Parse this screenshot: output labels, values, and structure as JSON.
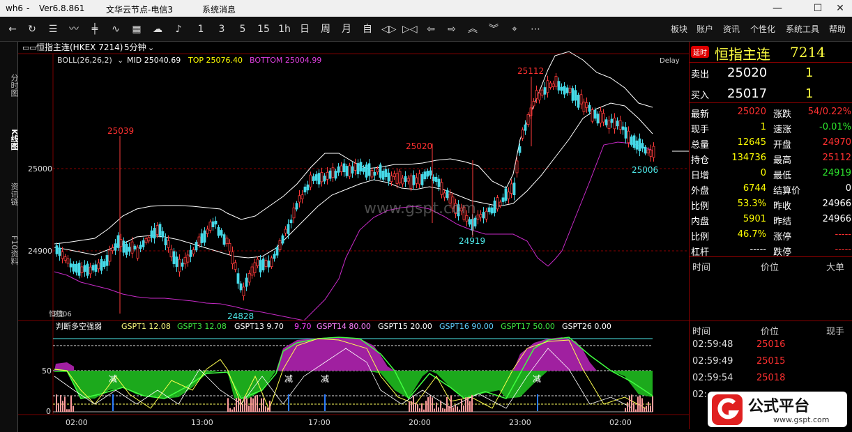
{
  "titlebar": {
    "app": "wh6",
    "sep": "-",
    "version": "Ver6.8.861",
    "server": "文华云节点-电信3",
    "sysmsg": "系统消息"
  },
  "toolbar": {
    "periods": [
      "1",
      "3",
      "5",
      "15",
      "1h",
      "日",
      "周",
      "月",
      "自"
    ],
    "menus": [
      "板块",
      "账户",
      "资讯",
      "个性化",
      "系统工具",
      "帮助"
    ]
  },
  "sidetabs": [
    "分时图",
    "K线图",
    "资讯链",
    "F10资料"
  ],
  "chart": {
    "header_left": "恒指主连(HKEX 7214)",
    "period": "5分钟",
    "boll_label": "BOLL(26,26,2)",
    "mid": "MID 25040.69",
    "top": "TOP 25076.40",
    "bottom": "BOTTOM 25004.99",
    "delay": "Delay",
    "price_labels": [
      "25000",
      "24900"
    ],
    "annotations": [
      "25112",
      "25039",
      "25020",
      "24919",
      "24828",
      "25006"
    ],
    "lower_label": "判断多空强弱",
    "gspt": [
      "GSPT1 12.08",
      "GSPT3 12.08",
      "GSPT13 9.70",
      "9.70",
      "GSPT14 80.00",
      "GSPT15 20.00",
      "GSPT16 90.00",
      "GSPT17 50.00",
      "GSPT26 0.00"
    ],
    "lower_axis": [
      "50",
      "0"
    ],
    "reduce_marks": [
      "减",
      "减",
      "减",
      "减"
    ],
    "time_axis": [
      "02:00",
      "13:00",
      "17:00",
      "20:00",
      "23:00",
      "02:00"
    ],
    "overlay_small": "恒指06",
    "left_small": "2主"
  },
  "panel": {
    "badge": "延时",
    "name": "恒指主连",
    "code": "7214",
    "sell_label": "卖出",
    "sell_price": "25020",
    "sell_vol": "1",
    "buy_label": "买入",
    "buy_price": "25017",
    "buy_vol": "1",
    "rows": [
      {
        "l1": "最新",
        "v1": "25020",
        "l2": "涨跌",
        "v2": "54/0.22%"
      },
      {
        "l1": "现手",
        "v1": "1",
        "l2": "速涨",
        "v2": "-0.01%"
      },
      {
        "l1": "总量",
        "v1": "12645",
        "l2": "开盘",
        "v2": "24970"
      },
      {
        "l1": "持仓",
        "v1": "134736",
        "l2": "最高",
        "v2": "25112"
      },
      {
        "l1": "日增",
        "v1": "0",
        "l2": "最低",
        "v2": "24919"
      },
      {
        "l1": "外盘",
        "v1": "6744",
        "l2": "结算价",
        "v2": "0"
      },
      {
        "l1": "比例",
        "v1": "53.3%",
        "l2": "昨收",
        "v2": "24966"
      },
      {
        "l1": "内盘",
        "v1": "5901",
        "l2": "昨结",
        "v2": "24966"
      },
      {
        "l1": "比例",
        "v1": "46.7%",
        "l2": "涨停",
        "v2": "-----"
      },
      {
        "l1": "杠杆",
        "v1": "-----",
        "l2": "跌停",
        "v2": "-----"
      }
    ],
    "ticks_header1": [
      "时间",
      "价位",
      "大单"
    ],
    "ticks_header2": [
      "时间",
      "价位",
      "现手"
    ],
    "ticks": [
      {
        "t": "02:59:48",
        "p": "25016"
      },
      {
        "t": "02:59:49",
        "p": "25015"
      },
      {
        "t": "02:59:54",
        "p": "25018"
      },
      {
        "t": "02:",
        "p": ""
      }
    ]
  },
  "watermark": {
    "logo_text": "公式平台",
    "url": "www.gspt.com",
    "center": "www.gspt.com"
  }
}
